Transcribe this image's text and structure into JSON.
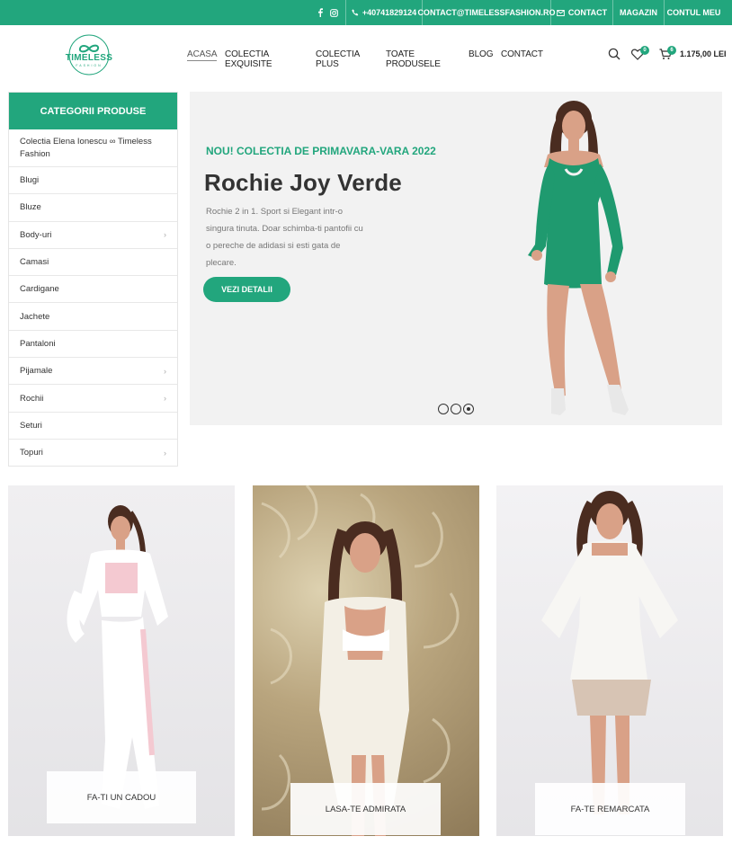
{
  "topbar": {
    "social": [
      "facebook-icon",
      "instagram-icon"
    ],
    "phone": "+40741829124",
    "email": "CONTACT@TIMELESSFASHION.RO",
    "contact": "CONTACT",
    "shop": "MAGAZIN",
    "account": "CONTUL MEU"
  },
  "header": {
    "logo_text": "TIMELESS",
    "logo_sub": "FASHION",
    "nav": [
      "ACASA",
      "COLECTIA EXQUISITE",
      "COLECTIA PLUS",
      "TOATE PRODUSELE",
      "BLOG",
      "CONTACT"
    ],
    "wishlist_count": "0",
    "cart_count": "6",
    "cart_total": "1.175,00 LEI"
  },
  "sidebar": {
    "title": "CATEGORII PRODUSE",
    "items": [
      {
        "label": "Colectia Elena Ionescu ∞ Timeless Fashion",
        "has_sub": false
      },
      {
        "label": "Blugi",
        "has_sub": false
      },
      {
        "label": "Bluze",
        "has_sub": false
      },
      {
        "label": "Body-uri",
        "has_sub": true
      },
      {
        "label": "Camasi",
        "has_sub": false
      },
      {
        "label": "Cardigane",
        "has_sub": false
      },
      {
        "label": "Jachete",
        "has_sub": false
      },
      {
        "label": "Pantaloni",
        "has_sub": false
      },
      {
        "label": "Pijamale",
        "has_sub": true
      },
      {
        "label": "Rochii",
        "has_sub": true
      },
      {
        "label": "Seturi",
        "has_sub": false
      },
      {
        "label": "Topuri",
        "has_sub": true
      }
    ]
  },
  "hero": {
    "kicker": "NOU! COLECTIA DE PRIMAVARA-VARA 2022",
    "title": "Rochie Joy Verde",
    "description": "Rochie 2 in 1. Sport si Elegant intr-o singura tinuta. Doar schimba-ti pantofii cu o pereche de adidasi si esti gata de plecare.",
    "button": "VEZI DETALII",
    "slides": 3,
    "active_slide": 3
  },
  "promos": [
    {
      "label": "FA-TI UN CADOU"
    },
    {
      "label": "LASA-TE ADMIRATA"
    },
    {
      "label": "FA-TE REMARCATA"
    }
  ],
  "colors": {
    "brand": "#22a67d",
    "dress_green": "#1f9a6f",
    "skin": "#d9a187",
    "hair": "#4a2c20"
  }
}
